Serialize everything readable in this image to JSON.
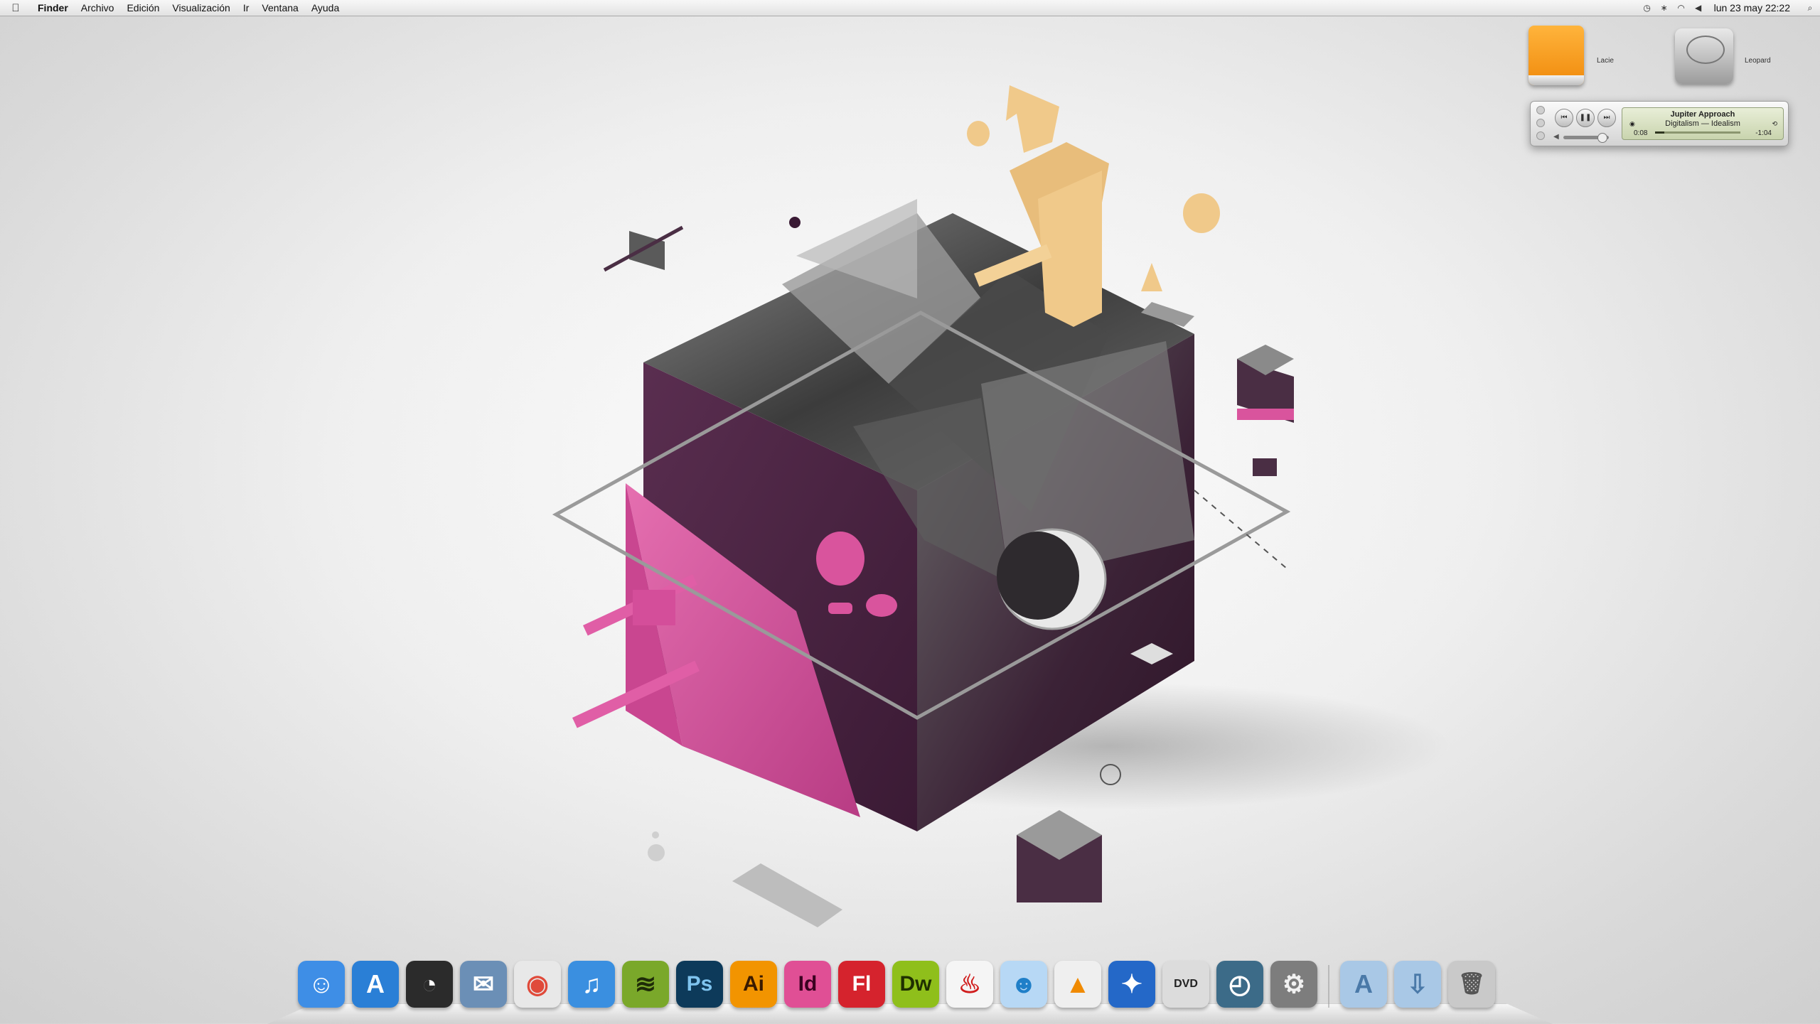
{
  "menubar": {
    "apple_icon": "apple-icon",
    "app_name": "Finder",
    "menus": [
      "Archivo",
      "Edición",
      "Visualización",
      "Ir",
      "Ventana",
      "Ayuda"
    ],
    "status_icons": [
      "time-machine-icon",
      "bluetooth-icon",
      "wifi-icon",
      "volume-icon"
    ],
    "clock": "lun 23 may  22:22",
    "spotlight_icon": "search-icon"
  },
  "desktop": {
    "icons": [
      {
        "label": "Lacie",
        "icon": "usb-drive-icon"
      },
      {
        "label": "Leopard",
        "icon": "hard-drive-icon"
      }
    ]
  },
  "mini_player": {
    "track": "Jupiter Approach",
    "artist_album": "Digitalism — Idealism",
    "elapsed": "0:08",
    "remaining": "-1:04",
    "progress_fraction": 0.11,
    "volume_fraction": 0.85,
    "buttons": {
      "prev": "⏮",
      "play": "❚❚",
      "next": "⏭"
    }
  },
  "dock": {
    "apps": [
      {
        "name": "finder",
        "glyph": "☺",
        "bg": "#3e8ee6",
        "fg": "#ffffff"
      },
      {
        "name": "app-store",
        "glyph": "A",
        "bg": "#2a7fd6",
        "fg": "#ffffff"
      },
      {
        "name": "dashboard",
        "glyph": "◔",
        "bg": "#2b2b2b",
        "fg": "#ffffff"
      },
      {
        "name": "mail",
        "glyph": "✉",
        "bg": "#6b8fb6",
        "fg": "#ffffff"
      },
      {
        "name": "chrome",
        "glyph": "◉",
        "bg": "#e8e8e8",
        "fg": "#e04a3a"
      },
      {
        "name": "itunes",
        "glyph": "♫",
        "bg": "#3a8fe0",
        "fg": "#ffffff"
      },
      {
        "name": "spotify",
        "glyph": "≋",
        "bg": "#7aa82a",
        "fg": "#1e2b08"
      },
      {
        "name": "photoshop",
        "glyph": "Ps",
        "bg": "#0d3a5a",
        "fg": "#7fc4ef"
      },
      {
        "name": "illustrator",
        "glyph": "Ai",
        "bg": "#f29400",
        "fg": "#3a1a00"
      },
      {
        "name": "indesign",
        "glyph": "Id",
        "bg": "#e04f95",
        "fg": "#3a0020"
      },
      {
        "name": "flash",
        "glyph": "Fl",
        "bg": "#d5232d",
        "fg": "#ffffff"
      },
      {
        "name": "dreamweaver",
        "glyph": "Dw",
        "bg": "#8fbf1b",
        "fg": "#1f3000"
      },
      {
        "name": "acrobat",
        "glyph": "♨",
        "bg": "#f5f5f5",
        "fg": "#d01c1c"
      },
      {
        "name": "messenger",
        "glyph": "☻",
        "bg": "#b7d8f5",
        "fg": "#1f7fc8"
      },
      {
        "name": "vlc",
        "glyph": "▲",
        "bg": "#efefef",
        "fg": "#f08a00"
      },
      {
        "name": "adium",
        "glyph": "✦",
        "bg": "#2468c8",
        "fg": "#ffffff"
      },
      {
        "name": "dvd-player",
        "glyph": "DVD",
        "bg": "#dcdcdc",
        "fg": "#222222"
      },
      {
        "name": "time-machine",
        "glyph": "◴",
        "bg": "#3c6b88",
        "fg": "#ffffff"
      },
      {
        "name": "system-preferences",
        "glyph": "⚙",
        "bg": "#7d7d7d",
        "fg": "#f1f1f1"
      }
    ],
    "stacks": [
      {
        "name": "applications-folder",
        "glyph": "A",
        "bg": "#a9c8e6",
        "fg": "#4a79a8"
      },
      {
        "name": "downloads-folder",
        "glyph": "⇩",
        "bg": "#a9c8e6",
        "fg": "#4a79a8"
      },
      {
        "name": "trash",
        "glyph": "🗑",
        "bg": "#c9c9c9",
        "fg": "#555555"
      }
    ]
  },
  "colors": {
    "purple": "#4a2440",
    "magenta": "#d9549d",
    "tan": "#f0c98a",
    "gray": "#bdbdbd"
  }
}
